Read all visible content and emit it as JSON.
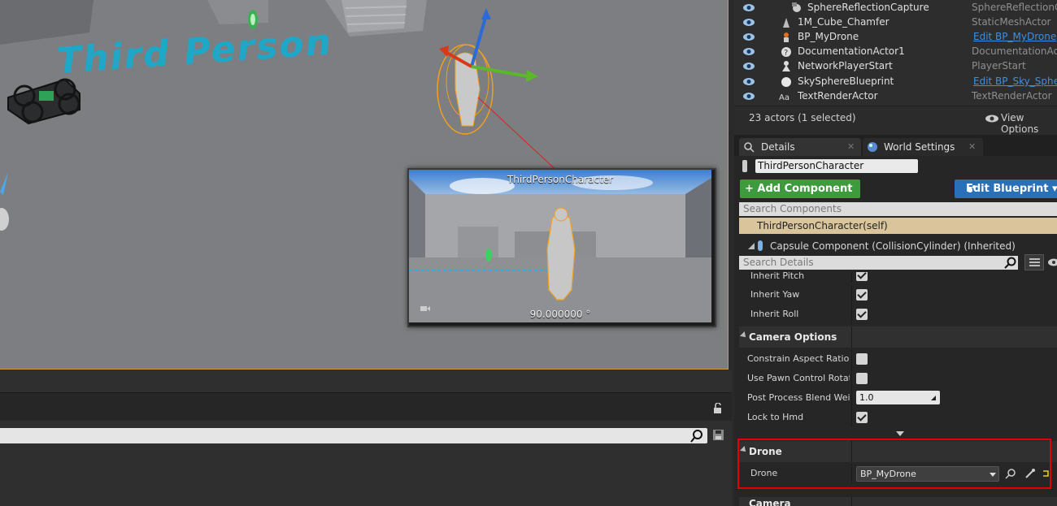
{
  "viewport": {
    "floor_text": "Third Person",
    "preview": {
      "title": "ThirdPersonCharacter",
      "angle": "90.000000 °"
    }
  },
  "log_panel": {
    "search_placeholder": ""
  },
  "outliner": {
    "rows": [
      {
        "name": "SphereReflectionCapture",
        "type": "SphereReflectionCa",
        "icon": "sphere-capture-icon",
        "link": false
      },
      {
        "name": "1M_Cube_Chamfer",
        "type": "StaticMeshActor",
        "icon": "static-mesh-icon",
        "link": false
      },
      {
        "name": "BP_MyDrone",
        "type": "Edit BP_MyDrone",
        "icon": "blueprint-actor-icon",
        "link": true
      },
      {
        "name": "DocumentationActor1",
        "type": "DocumentationActor",
        "icon": "documentation-icon",
        "link": false
      },
      {
        "name": "NetworkPlayerStart",
        "type": "PlayerStart",
        "icon": "player-start-icon",
        "link": false
      },
      {
        "name": "SkySphereBlueprint",
        "type": "Edit BP_Sky_Sphere",
        "icon": "sky-sphere-icon",
        "link": true
      },
      {
        "name": "TextRenderActor",
        "type": "TextRenderActor",
        "icon": "text-render-icon",
        "link": false
      }
    ],
    "actor_count": "23 actors (1 selected)",
    "view_options": "View Options"
  },
  "tabs": {
    "details": "Details",
    "world_settings": "World Settings",
    "close": "✕"
  },
  "details": {
    "actor_name": "ThirdPersonCharacter",
    "add_component": "+ Add Component ▾",
    "edit_blueprint": "Edit Blueprint ▾",
    "search_components_placeholder": "Search Components",
    "self_component": "ThirdPersonCharacter(self)",
    "capsule_component": "Capsule Component (CollisionCylinder) (Inherited)",
    "search_details_placeholder": "Search Details",
    "rotation_props": [
      {
        "label": "Inherit Pitch",
        "checked": true
      },
      {
        "label": "Inherit Yaw",
        "checked": true
      },
      {
        "label": "Inherit Roll",
        "checked": true
      }
    ],
    "camera_options": {
      "title": "Camera Options",
      "constrain_aspect": {
        "label": "Constrain Aspect Ratio",
        "checked": false
      },
      "use_pawn_control": {
        "label": "Use Pawn Control Rotation",
        "checked": false
      },
      "post_process": {
        "label": "Post Process Blend Weight",
        "value": "1.0"
      },
      "lock_hmd": {
        "label": "Lock to Hmd",
        "checked": true
      }
    },
    "drone_category": {
      "title": "Drone",
      "label": "Drone",
      "value": "BP_MyDrone"
    },
    "camera_category": "Camera"
  }
}
